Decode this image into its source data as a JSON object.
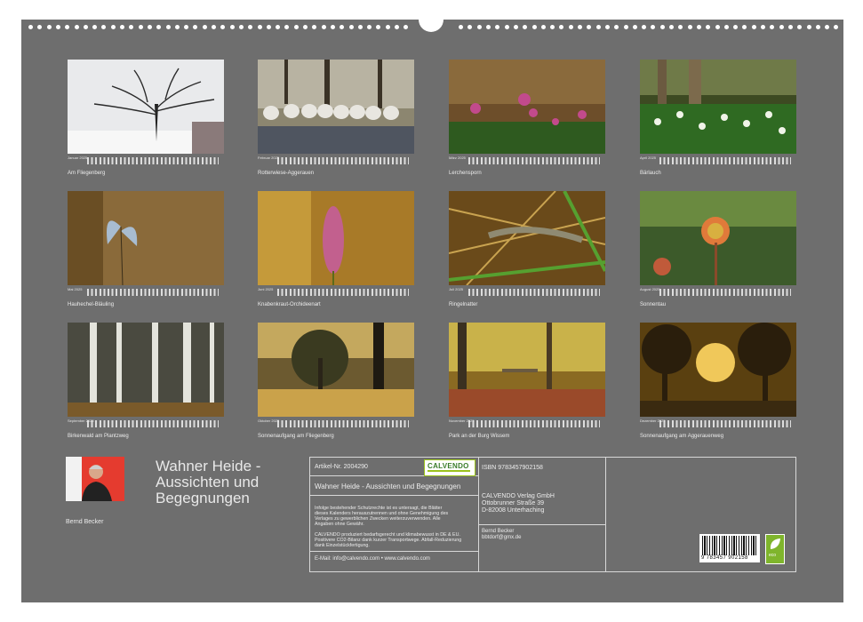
{
  "calendar": {
    "title": "Wahner Heide - Aussichten und Begegnungen",
    "author": "Bernd Becker",
    "months": [
      {
        "month_label": "Januar 2025",
        "caption": "Am Fliegenberg",
        "scene": "snowy-tree"
      },
      {
        "month_label": "Februar 2025",
        "caption": "Rotterwiese-Aggerauen",
        "scene": "sheep"
      },
      {
        "month_label": "März 2025",
        "caption": "Lerchensporn",
        "scene": "pink-flowers"
      },
      {
        "month_label": "April 2025",
        "caption": "Bärlauch",
        "scene": "wild-garlic"
      },
      {
        "month_label": "Mai 2025",
        "caption": "Hauhechel-Bläuling",
        "scene": "butterfly"
      },
      {
        "month_label": "Juni 2025",
        "caption": "Knabenkraut-Orchideenart",
        "scene": "orchid"
      },
      {
        "month_label": "Juli 2025",
        "caption": "Ringelnatter",
        "scene": "snake"
      },
      {
        "month_label": "August 2025",
        "caption": "Sonnentau",
        "scene": "sundew"
      },
      {
        "month_label": "September 2025",
        "caption": "Birkenwald am Plantzweg",
        "scene": "birch"
      },
      {
        "month_label": "Oktober 2025",
        "caption": "Sonnenaufgang am Fliegenberg",
        "scene": "sunrise-tree"
      },
      {
        "month_label": "November 2025",
        "caption": "Park an der Burg Wissem",
        "scene": "autumn-park"
      },
      {
        "month_label": "Dezember 2025",
        "caption": "Sonnenaufgang am Aggerauenweg",
        "scene": "sunrays"
      }
    ]
  },
  "info": {
    "article_label": "Artikel-Nr. 2004290",
    "logo_text": "CALVENDO",
    "title_line": "Wahner Heide - Aussichten und Begegnungen",
    "isbn": "ISBN 9783457902158",
    "publisher": "CALVENDO Verlag GmbH",
    "street": "Ottobrunner Straße 39",
    "city": "D-82008 Unterhaching",
    "legal": "Infolge bestehender Schutzrechte ist es untersagt, die Blätter dieses Kalenders herauszutrennen und ohne Genehmigung des Verlages zu gewerblichen Zwecken weiterzuverwenden. Alle Angaben ohne Gewähr.",
    "eco_text": "CALVENDO produziert bedarfsgerecht und klimabewusst in DE & EU. Positivere CO2-Bilanz dank kurzer Transportwege. Abfall-Reduzierung dank Einzelstückfertigung.",
    "contact": "E-Mail: info@calvendo.com • www.calvendo.com",
    "author_name": "Bernd Becker",
    "author_email": "bbtdorf@gmx.de",
    "barcode_number": "9 783457 902158",
    "eco_label": "eco"
  },
  "colors": {
    "page_bg": "#6e6e6e",
    "text": "#ececec",
    "logo_green": "#9bc31c"
  }
}
